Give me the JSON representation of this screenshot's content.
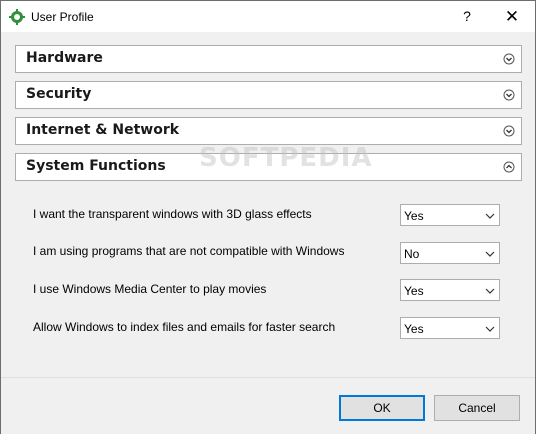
{
  "window": {
    "title": "User Profile",
    "help_glyph": "?",
    "close_glyph": "✕"
  },
  "sections": [
    {
      "label": "Hardware",
      "state": "collapsed"
    },
    {
      "label": "Security",
      "state": "collapsed"
    },
    {
      "label": "Internet & Network",
      "state": "collapsed"
    },
    {
      "label": "System Functions",
      "state": "expanded"
    }
  ],
  "options": [
    {
      "label": "I want the transparent windows with 3D glass effects",
      "value": "Yes"
    },
    {
      "label": "I am using programs that are not compatible with Windows",
      "value": "No"
    },
    {
      "label": "I use Windows Media Center to play movies",
      "value": "Yes"
    },
    {
      "label": "Allow Windows to index files and emails for faster search",
      "value": "Yes"
    }
  ],
  "footer": {
    "ok_label": "OK",
    "cancel_label": "Cancel"
  },
  "watermark": "SOFTPEDIA",
  "colors": {
    "accent": "#0078d7",
    "panel_bg": "#f0f0f0",
    "border": "#adadad"
  }
}
